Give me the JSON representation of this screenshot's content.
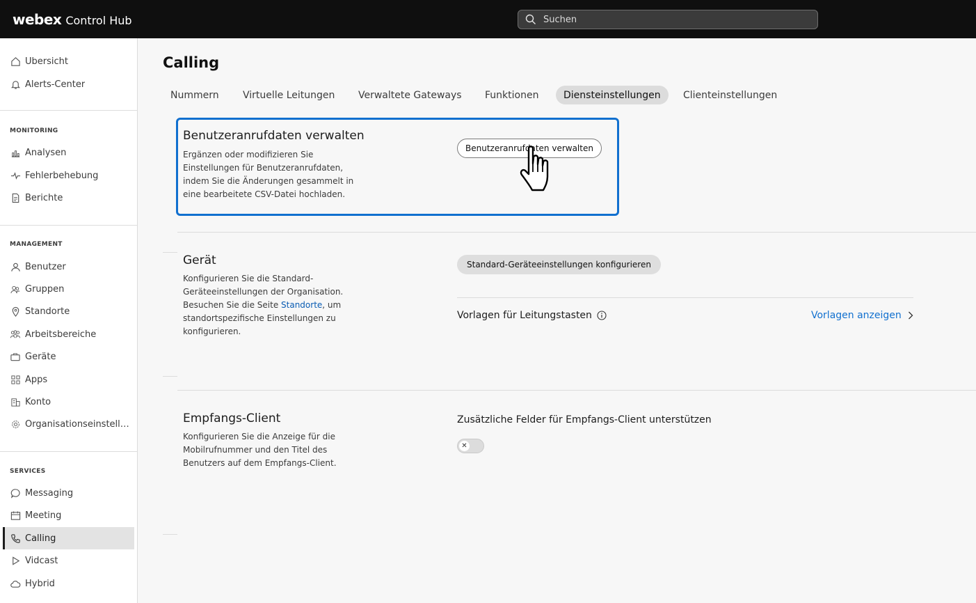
{
  "app": {
    "brand_logo": "webex",
    "brand_product": "Control Hub",
    "search_placeholder": "Suchen"
  },
  "sidebar": {
    "top_items": [
      {
        "label": "Übersicht",
        "icon": "home-icon"
      },
      {
        "label": "Alerts-Center",
        "icon": "bell-icon"
      }
    ],
    "sections": [
      {
        "label": "MONITORING",
        "items": [
          {
            "label": "Analysen",
            "icon": "analytics-icon"
          },
          {
            "label": "Fehlerbehebung",
            "icon": "pulse-icon"
          },
          {
            "label": "Berichte",
            "icon": "report-icon"
          }
        ]
      },
      {
        "label": "MANAGEMENT",
        "items": [
          {
            "label": "Benutzer",
            "icon": "user-icon"
          },
          {
            "label": "Gruppen",
            "icon": "group-icon"
          },
          {
            "label": "Standorte",
            "icon": "location-icon"
          },
          {
            "label": "Arbeitsbereiche",
            "icon": "workspace-icon"
          },
          {
            "label": "Geräte",
            "icon": "device-icon"
          },
          {
            "label": "Apps",
            "icon": "apps-icon"
          },
          {
            "label": "Konto",
            "icon": "account-icon"
          },
          {
            "label": "Organisationseinstellungen",
            "icon": "gear-icon"
          }
        ]
      },
      {
        "label": "SERVICES",
        "items": [
          {
            "label": "Messaging",
            "icon": "chat-icon"
          },
          {
            "label": "Meeting",
            "icon": "calendar-icon"
          },
          {
            "label": "Calling",
            "icon": "phone-icon",
            "active": true
          },
          {
            "label": "Vidcast",
            "icon": "play-icon"
          },
          {
            "label": "Hybrid",
            "icon": "cloud-icon"
          }
        ]
      }
    ]
  },
  "page": {
    "title": "Calling",
    "tabs": [
      {
        "label": "Nummern"
      },
      {
        "label": "Virtuelle Leitungen"
      },
      {
        "label": "Verwaltete Gateways"
      },
      {
        "label": "Funktionen"
      },
      {
        "label": "Diensteinstellungen",
        "active": true
      },
      {
        "label": "Clienteinstellungen"
      }
    ]
  },
  "sections": {
    "user_call_data": {
      "title": "Benutzeranrufdaten verwalten",
      "description": "Ergänzen oder modifizieren Sie Einstellungen für Benutzeranrufdaten, indem Sie die Änderungen gesammelt in eine bearbeitete CSV-Datei hochladen.",
      "button_label": "Benutzeranrufdaten verwalten"
    },
    "device": {
      "title": "Gerät",
      "description_before": "Konfigurieren Sie die Standard-Geräteeinstellungen der Organisation. Besuchen Sie die Seite ",
      "description_link": "Standorte",
      "description_after": ", um standortspezifische Einstellungen zu konfigurieren.",
      "button_label": "Standard-Geräteeinstellungen konfigurieren",
      "line_key_label": "Vorlagen für Leitungstasten",
      "line_key_link": "Vorlagen anzeigen"
    },
    "reception_client": {
      "title": "Empfangs-Client",
      "description": "Konfigurieren Sie die Anzeige für die Mobilrufnummer und den Titel des Benutzers auf dem Empfangs-Client.",
      "toggle_label": "Zusätzliche Felder für Empfangs-Client unterstützen",
      "toggle_on": false
    }
  },
  "colors": {
    "topbar": "#0f0f0f",
    "highlight": "#1170cf",
    "link": "#1170cf"
  }
}
